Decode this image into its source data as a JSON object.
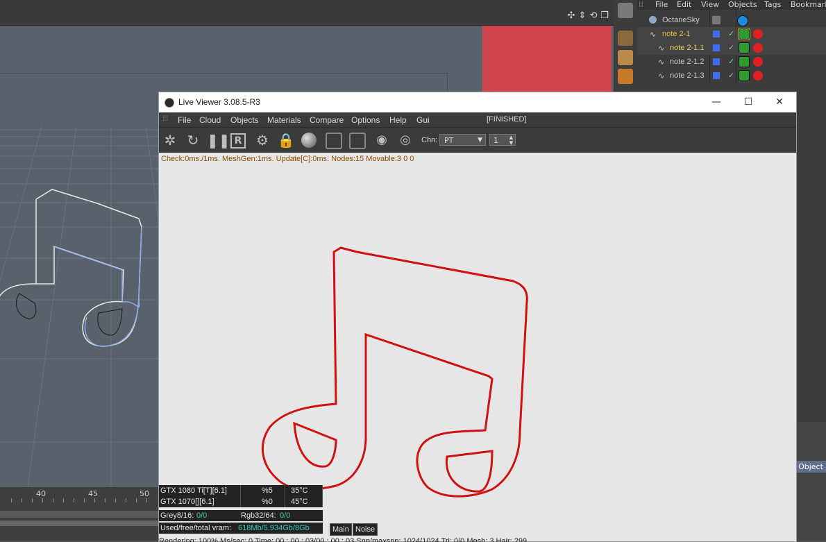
{
  "object_manager": {
    "menu": [
      "File",
      "Edit",
      "View",
      "Objects",
      "Tags",
      "Bookmark"
    ],
    "objects": [
      {
        "name": "OctaneSky",
        "selected": false
      },
      {
        "name": "note 2-1",
        "selected": true
      },
      {
        "name": "note 2-1.1",
        "selected": true
      },
      {
        "name": "note 2-1.2",
        "selected": false
      },
      {
        "name": "note 2-1.3",
        "selected": false
      }
    ],
    "attribute_tab": "Object"
  },
  "timeline": {
    "frames": [
      "40",
      "45",
      "50"
    ]
  },
  "live_viewer": {
    "title": "Live Viewer 3.08.5-R3",
    "menu": [
      "File",
      "Cloud",
      "Objects",
      "Materials",
      "Compare",
      "Options",
      "Help",
      "Gui"
    ],
    "status": "[FINISHED]",
    "channel_label": "Chn:",
    "channel_value": "PT",
    "channel_options": [
      "PT"
    ],
    "spin_value": "1",
    "stats": "Check:0ms./1ms. MeshGen:1ms. Update[C]:0ms. Nodes:15 Movable:3  0 0",
    "gpus": [
      {
        "name": "GTX 1080 Ti[T][6.1]",
        "usage": "%5",
        "temp": "35°C"
      },
      {
        "name": "GTX 1070[][6.1]",
        "usage": "%0",
        "temp": "45°C"
      }
    ],
    "grey_label": "Grey8/16:",
    "grey_value": "0/0",
    "rgb_label": "Rgb32/64:",
    "rgb_value": "0/0",
    "vram_label": "Used/free/total vram:",
    "vram_value": "618Mb/5.934Gb/8Gb",
    "tabs": [
      "Main",
      "Noise"
    ],
    "bottom_status": "Rendering: 100%  Ms/sec: 0    Time: 00 : 00 : 03/00 : 00 : 03   Spp/maxspp: 1024/1024     Tri: 0/0   Mesh: 3  Hair: 299"
  },
  "colors": {
    "render_stroke": "#d11111",
    "selected_object": "#e8b83a",
    "accent": "#3ac8b0"
  }
}
